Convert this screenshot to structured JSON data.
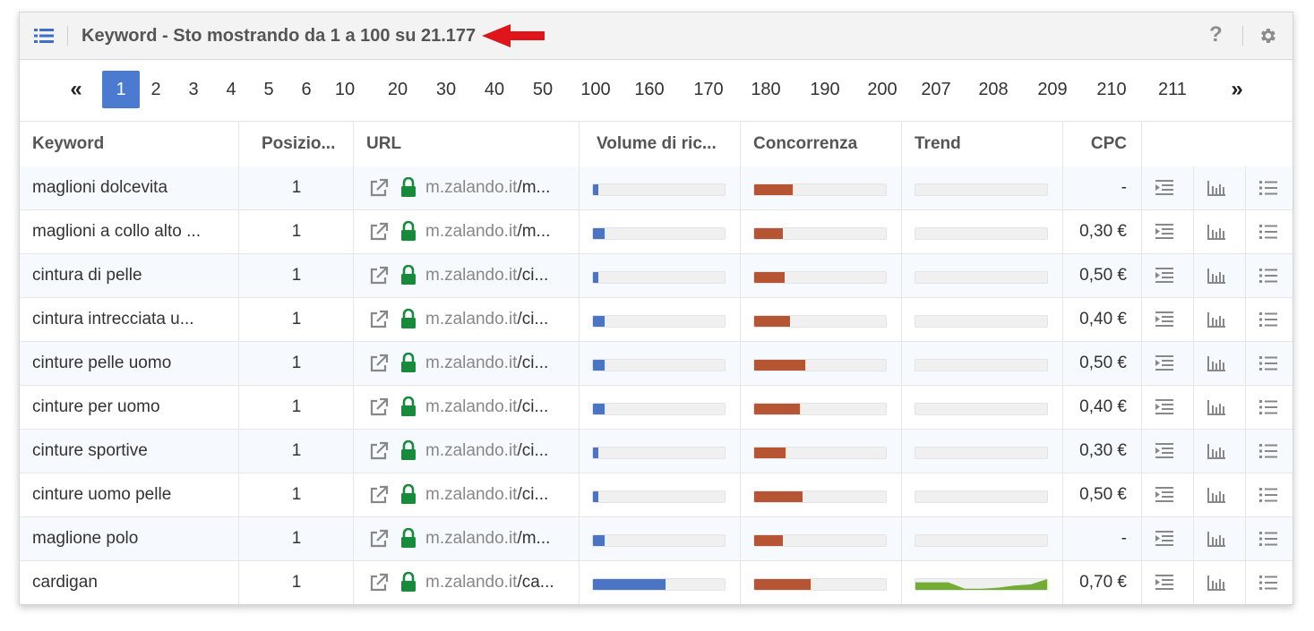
{
  "header": {
    "title": "Keyword - Sto mostrando da 1 a 100 su 21.177",
    "list_icon": "list-icon",
    "help_label": "?",
    "settings_icon": "gear-icon",
    "arrow_color": "#e0151b"
  },
  "pager": {
    "first": "«",
    "last": "»",
    "active": "1",
    "pages": [
      "1",
      "2",
      "3",
      "4",
      "5",
      "6",
      "10",
      "20",
      "30",
      "40",
      "50",
      "100",
      "160",
      "170",
      "180",
      "190",
      "200",
      "207",
      "208",
      "209",
      "210",
      "211"
    ]
  },
  "table": {
    "columns": [
      "Keyword",
      "Posizio...",
      "URL",
      "Volume di ric...",
      "Concorrenza",
      "Trend",
      "CPC"
    ],
    "rows": [
      {
        "keyword": "maglioni dolcevita",
        "position": "1",
        "host": "m.zalando.it",
        "path": "/m...",
        "volume": 0.04,
        "competition": 0.29,
        "trend": [],
        "cpc": "-"
      },
      {
        "keyword": "maglioni a collo alto ...",
        "position": "1",
        "host": "m.zalando.it",
        "path": "/m...",
        "volume": 0.09,
        "competition": 0.22,
        "trend": [],
        "cpc": "0,30 €"
      },
      {
        "keyword": "cintura di pelle",
        "position": "1",
        "host": "m.zalando.it",
        "path": "/ci...",
        "volume": 0.04,
        "competition": 0.23,
        "trend": [],
        "cpc": "0,50 €"
      },
      {
        "keyword": "cintura intrecciata u...",
        "position": "1",
        "host": "m.zalando.it",
        "path": "/ci...",
        "volume": 0.09,
        "competition": 0.27,
        "trend": [],
        "cpc": "0,40 €"
      },
      {
        "keyword": "cinture pelle uomo",
        "position": "1",
        "host": "m.zalando.it",
        "path": "/ci...",
        "volume": 0.09,
        "competition": 0.39,
        "trend": [],
        "cpc": "0,50 €"
      },
      {
        "keyword": "cinture per uomo",
        "position": "1",
        "host": "m.zalando.it",
        "path": "/ci...",
        "volume": 0.09,
        "competition": 0.35,
        "trend": [],
        "cpc": "0,40 €"
      },
      {
        "keyword": "cinture sportive",
        "position": "1",
        "host": "m.zalando.it",
        "path": "/ci...",
        "volume": 0.04,
        "competition": 0.24,
        "trend": [],
        "cpc": "0,30 €"
      },
      {
        "keyword": "cinture uomo pelle",
        "position": "1",
        "host": "m.zalando.it",
        "path": "/ci...",
        "volume": 0.04,
        "competition": 0.37,
        "trend": [],
        "cpc": "0,50 €"
      },
      {
        "keyword": "maglione polo",
        "position": "1",
        "host": "m.zalando.it",
        "path": "/m...",
        "volume": 0.09,
        "competition": 0.22,
        "trend": [],
        "cpc": "-"
      },
      {
        "keyword": "cardigan",
        "position": "1",
        "host": "m.zalando.it",
        "path": "/ca...",
        "volume": 0.55,
        "competition": 0.43,
        "trend": [
          0.7,
          0.7,
          0.7,
          0.1,
          0.1,
          0.2,
          0.4,
          0.5,
          1.0
        ],
        "cpc": "0,70 €"
      }
    ],
    "row_actions": [
      "indent-icon",
      "bar-chart-icon",
      "list-icon"
    ]
  },
  "colors": {
    "active_page": "#4a7bd0",
    "volume_bar": "#4b74c4",
    "competition_bar": "#b65533",
    "trend_fill": "#72ac35",
    "lock": "#178a3c"
  }
}
